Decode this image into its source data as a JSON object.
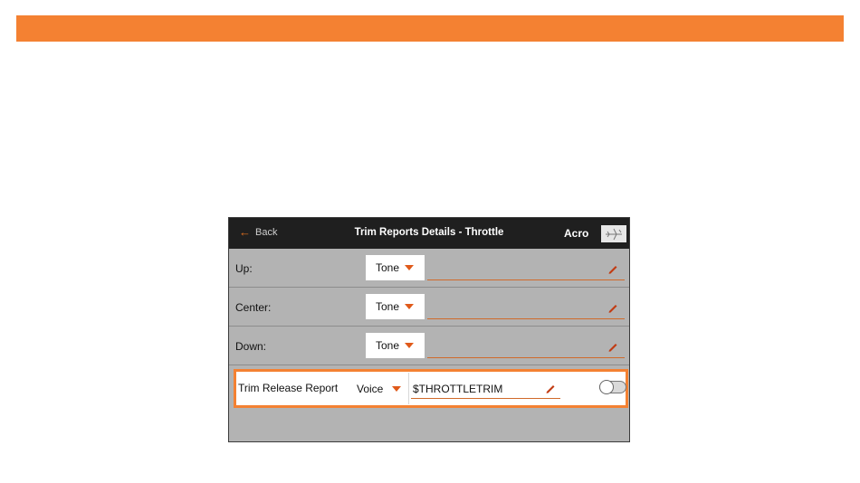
{
  "header": {
    "back_label": "Back",
    "title": "Trim Reports Details - Throttle",
    "mode": "Acro"
  },
  "rows": [
    {
      "label": "Up:",
      "select_value": "Tone",
      "text_value": ""
    },
    {
      "label": "Center:",
      "select_value": "Tone",
      "text_value": ""
    },
    {
      "label": "Down:",
      "select_value": "Tone",
      "text_value": ""
    }
  ],
  "release_row": {
    "label": "Trim Release Report",
    "select_value": "Voice",
    "text_value": "$THROTTLETRIM",
    "toggle_on": false
  },
  "colors": {
    "accent": "#f48132",
    "caret": "#e05a1a",
    "titlebar": "#1f1f1f",
    "screen_bg": "#b3b3b3"
  },
  "icons": {
    "back": "left-arrow-icon",
    "model": "airplane-icon",
    "edit": "pencil-icon",
    "dropdown": "caret-down-icon"
  }
}
